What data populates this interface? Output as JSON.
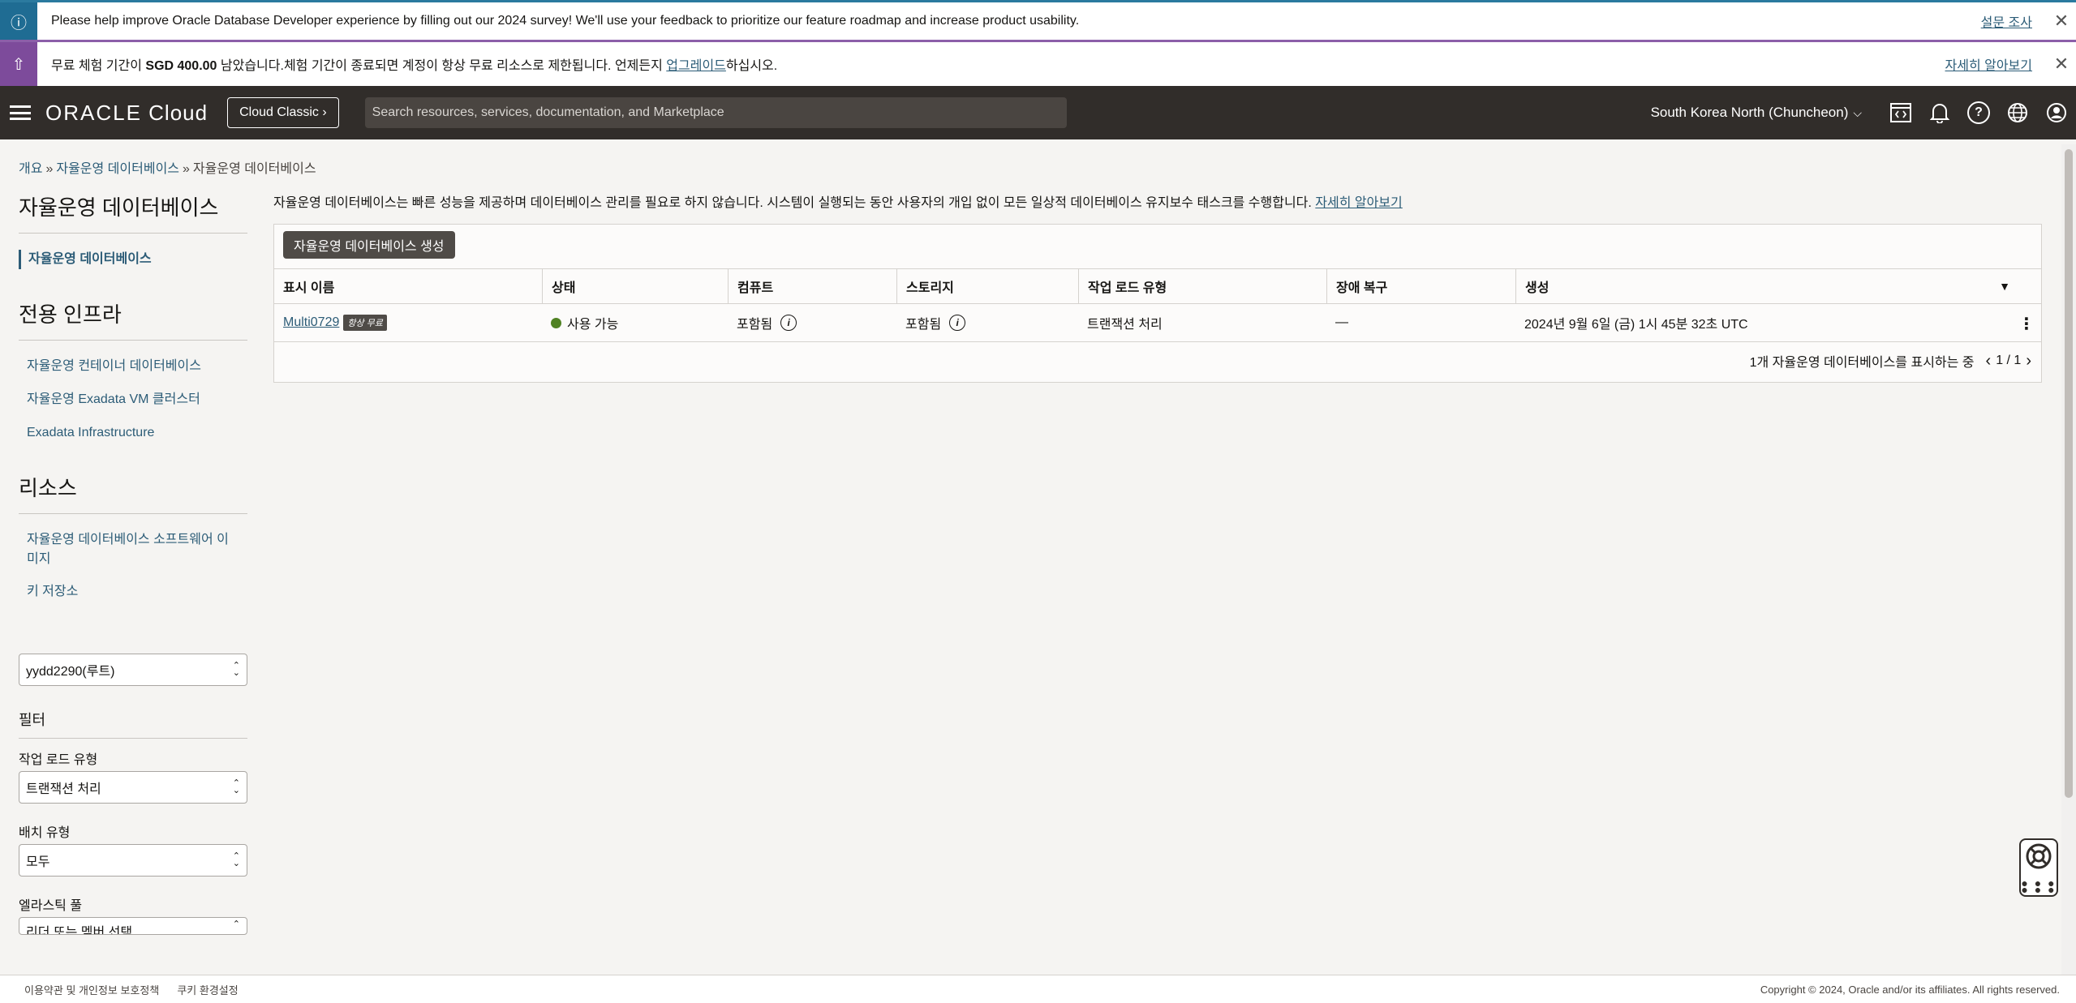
{
  "banners": {
    "survey": {
      "text": "Please help improve Oracle Database Developer experience by filling out our 2024 survey! We'll use your feedback to prioritize our feature roadmap and increase product usability.",
      "link": "설문 조사"
    },
    "trial": {
      "text_before": "무료 체험 기간이 ",
      "amount": "SGD 400.00",
      "text_mid": " 남았습니다.체험 기간이 종료되면 계정이 항상 무료 리소스로 제한됩니다. 언제든지 ",
      "upgrade_link": "업그레이드",
      "text_after": "하십시오.",
      "link": "자세히 알아보기"
    }
  },
  "topnav": {
    "logo_strong": "ORACLE",
    "logo_light": " Cloud",
    "classic_label": "Cloud Classic",
    "search_placeholder": "Search resources, services, documentation, and Marketplace",
    "region": "South Korea North (Chuncheon)"
  },
  "breadcrumb": [
    "개요",
    "자율운영 데이터베이스",
    "자율운영 데이터베이스"
  ],
  "sidebar": {
    "section1_title": "자율운영 데이터베이스",
    "section1_items": [
      "자율운영 데이터베이스"
    ],
    "section2_title": "전용 인프라",
    "section2_items": [
      "자율운영 컨테이너 데이터베이스",
      "자율운영 Exadata VM 클러스터",
      "Exadata Infrastructure"
    ],
    "section3_title": "리소스",
    "section3_items": [
      "자율운영 데이터베이스 소프트웨어 이미지",
      "키 저장소"
    ],
    "compartment": "yydd2290(루트)",
    "filter_title": "필터",
    "workload_label": "작업 로드 유형",
    "workload_value": "트랜잭션 처리",
    "deploy_label": "배치 유형",
    "deploy_value": "모두",
    "elastic_label": "엘라스틱 풀",
    "elastic_value": "리더 또는 멤버 선택"
  },
  "main": {
    "description": "자율운영 데이터베이스는 빠른 성능을 제공하며 데이터베이스 관리를 필요로 하지 않습니다. 시스템이 실행되는 동안 사용자의 개입 없이 모든 일상적 데이터베이스 유지보수 태스크를 수행합니다. ",
    "learn_more": "자세히 알아보기",
    "create_button": "자율운영 데이터베이스 생성",
    "columns": [
      "표시 이름",
      "상태",
      "컴퓨트",
      "스토리지",
      "작업 로드 유형",
      "장애 복구",
      "생성"
    ],
    "rows": [
      {
        "name": "Multi0729",
        "badge": "항상 무료",
        "status": "사용 가능",
        "compute": "포함됨",
        "storage": "포함됨",
        "workload": "트랜잭션 처리",
        "dr": "—",
        "created": "2024년 9월 6일 (금) 1시 45분 32초 UTC"
      }
    ],
    "pager_text": "1개 자율운영 데이터베이스를 표시하는 중",
    "page_num": "1 / 1"
  },
  "footer": {
    "terms": "이용약관 및 개인정보 보호정책",
    "cookies": "쿠키 환경설정",
    "copyright": "Copyright © 2024, Oracle and/or its affiliates. All rights reserved."
  },
  "colors": {
    "nav_bg": "#312d2a",
    "link": "#2c5c77",
    "status_available": "#508223",
    "survey_accent": "#1f6c93",
    "trial_accent": "#7d4b9b"
  }
}
